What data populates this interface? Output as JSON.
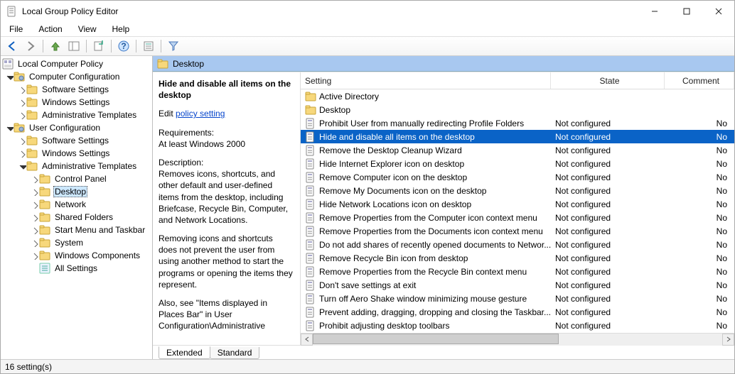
{
  "window": {
    "title": "Local Group Policy Editor"
  },
  "menus": [
    "File",
    "Action",
    "View",
    "Help"
  ],
  "tree_root": "Local Computer Policy",
  "comp_cfg": "Computer Configuration",
  "user_cfg": "User Configuration",
  "sw": "Software Settings",
  "win": "Windows Settings",
  "admt": "Administrative Templates",
  "tree_admin_children": [
    "Control Panel",
    "Desktop",
    "Network",
    "Shared Folders",
    "Start Menu and Taskbar",
    "System",
    "Windows Components",
    "All Settings"
  ],
  "path_header": "Desktop",
  "detail": {
    "heading": "Hide and disable all items on the desktop",
    "edit_prefix": "Edit ",
    "edit_link": "policy setting ",
    "req_label": "Requirements:",
    "req_text": "At least Windows 2000",
    "desc_label": "Description:",
    "desc1": "Removes icons, shortcuts, and other default and user-defined items from the desktop, including Briefcase, Recycle Bin, Computer, and Network Locations.",
    "desc2": "Removing icons and shortcuts does not prevent the user from using another method to start the programs or opening the items they represent.",
    "desc3": "Also, see \"Items displayed in Places Bar\" in User Configuration\\Administrative"
  },
  "columns": {
    "setting": "Setting",
    "state": "State",
    "comment": "Comment"
  },
  "rows": [
    {
      "type": "folder",
      "setting": "Active Directory"
    },
    {
      "type": "folder",
      "setting": "Desktop"
    },
    {
      "type": "policy",
      "setting": "Prohibit User from manually redirecting Profile Folders",
      "state": "Not configured",
      "comment": "No"
    },
    {
      "type": "policy",
      "setting": "Hide and disable all items on the desktop",
      "state": "Not configured",
      "comment": "No",
      "selected": true
    },
    {
      "type": "policy",
      "setting": "Remove the Desktop Cleanup Wizard",
      "state": "Not configured",
      "comment": "No"
    },
    {
      "type": "policy",
      "setting": "Hide Internet Explorer icon on desktop",
      "state": "Not configured",
      "comment": "No"
    },
    {
      "type": "policy",
      "setting": "Remove Computer icon on the desktop",
      "state": "Not configured",
      "comment": "No"
    },
    {
      "type": "policy",
      "setting": "Remove My Documents icon on the desktop",
      "state": "Not configured",
      "comment": "No"
    },
    {
      "type": "policy",
      "setting": "Hide Network Locations icon on desktop",
      "state": "Not configured",
      "comment": "No"
    },
    {
      "type": "policy",
      "setting": "Remove Properties from the Computer icon context menu",
      "state": "Not configured",
      "comment": "No"
    },
    {
      "type": "policy",
      "setting": "Remove Properties from the Documents icon context menu",
      "state": "Not configured",
      "comment": "No"
    },
    {
      "type": "policy",
      "setting": "Do not add shares of recently opened documents to Networ...",
      "state": "Not configured",
      "comment": "No"
    },
    {
      "type": "policy",
      "setting": "Remove Recycle Bin icon from desktop",
      "state": "Not configured",
      "comment": "No"
    },
    {
      "type": "policy",
      "setting": "Remove Properties from the Recycle Bin context menu",
      "state": "Not configured",
      "comment": "No"
    },
    {
      "type": "policy",
      "setting": "Don't save settings at exit",
      "state": "Not configured",
      "comment": "No"
    },
    {
      "type": "policy",
      "setting": "Turn off Aero Shake window minimizing mouse gesture",
      "state": "Not configured",
      "comment": "No"
    },
    {
      "type": "policy",
      "setting": "Prevent adding, dragging, dropping and closing the Taskbar...",
      "state": "Not configured",
      "comment": "No"
    },
    {
      "type": "policy",
      "setting": "Prohibit adjusting desktop toolbars",
      "state": "Not configured",
      "comment": "No"
    }
  ],
  "tabs": {
    "extended": "Extended",
    "standard": "Standard"
  },
  "status": "16 setting(s)"
}
